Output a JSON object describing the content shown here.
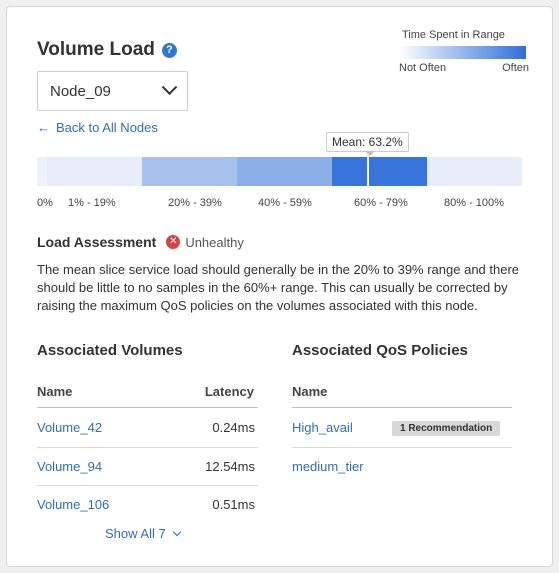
{
  "header": {
    "title": "Volume Load",
    "help_icon": "?"
  },
  "legend": {
    "title": "Time Spent in Range",
    "low_label": "Not Often",
    "high_label": "Often",
    "gradient_from": "#ffffff",
    "gradient_to": "#2f6fd8"
  },
  "node_select": {
    "value": "Node_09"
  },
  "back_link": {
    "label": "Back to All Nodes"
  },
  "chart_data": {
    "type": "heatmap",
    "mean_label": "Mean: 63.2%",
    "mean_value": 63.2,
    "bins": [
      {
        "label": "0%",
        "intensity": 0.05
      },
      {
        "label": "1% - 19%",
        "intensity": 0.1
      },
      {
        "label": "20% - 39%",
        "intensity": 0.35
      },
      {
        "label": "40% - 59%",
        "intensity": 0.5
      },
      {
        "label": "60% - 79%",
        "intensity": 1.0
      },
      {
        "label": "80% - 100%",
        "intensity": 0.05
      }
    ],
    "split_bin_60_79": [
      1.0,
      0.95
    ]
  },
  "assessment": {
    "title": "Load Assessment",
    "status": "Unhealthy",
    "status_color": "#d64545",
    "description": "The mean slice service load should generally be in the 20% to 39% range and there should be little to no samples in the 60%+ range. This can usually be corrected by raising the maximum QoS policies on the volumes associated with this node."
  },
  "volumes": {
    "title": "Associated Volumes",
    "columns": [
      "Name",
      "Latency"
    ],
    "rows": [
      {
        "name": "Volume_42",
        "latency": "0.24ms"
      },
      {
        "name": "Volume_94",
        "latency": "12.54ms"
      },
      {
        "name": "Volume_106",
        "latency": "0.51ms"
      }
    ],
    "show_all": "Show All 7"
  },
  "qos": {
    "title": "Associated QoS Policies",
    "columns": [
      "Name"
    ],
    "rows": [
      {
        "name": "High_avail",
        "badge": "1 Recommendation"
      },
      {
        "name": "medium_tier",
        "badge": ""
      }
    ]
  }
}
